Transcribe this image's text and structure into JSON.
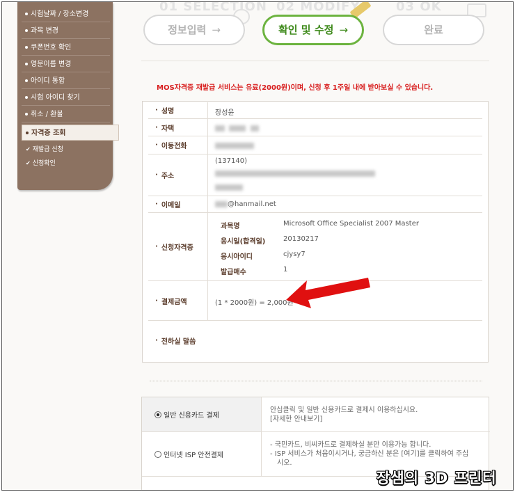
{
  "sidebar": {
    "items": [
      {
        "label": "시험날짜 / 장소변경"
      },
      {
        "label": "과목 변경"
      },
      {
        "label": "쿠폰번호 확인"
      },
      {
        "label": "영문이름 변경"
      },
      {
        "label": "아이디 통합"
      },
      {
        "label": "시험 아이디 찾기"
      },
      {
        "label": "취소 / 환불"
      },
      {
        "label": "자격증 조회"
      }
    ],
    "subitems": [
      {
        "label": "재발급 신청"
      },
      {
        "label": "신청확인"
      }
    ]
  },
  "steps": {
    "captions": [
      "01 SELECTION",
      "02 MODIFY",
      "03 OK"
    ],
    "items": [
      {
        "label": "정보입력",
        "arrow": "→"
      },
      {
        "label": "확인 및 수정",
        "arrow": "→"
      },
      {
        "label": "완료",
        "arrow": ""
      }
    ]
  },
  "notice": "MOS자격증 재발급 서비스는 유료(2000원)이며, 신청 후 1주일 내에 받아보실 수 있습니다.",
  "info": {
    "name_label": "성명",
    "name_value": "장성윤",
    "home_label": "자택",
    "mobile_label": "이동전화",
    "address_label": "주소",
    "postcode": "(137140)",
    "email_label": "이메일",
    "email_value": "@hanmail.net",
    "cert_label": "신청자격증",
    "cert": {
      "subject_label": "과목명",
      "subject_value": "Microsoft Office Specialist 2007 Master",
      "date_label": "응시일(합격일)",
      "date_value": "20130217",
      "id_label": "응시아이디",
      "id_value": "cjysy7",
      "count_label": "발급매수",
      "count_value": "1"
    },
    "pay_label": "결제금액",
    "pay_value": "(1 * 2000원) = 2,000원",
    "msg_label": "전하실 말씀"
  },
  "payment": {
    "card_label": "일반 신용카드 결제",
    "card_desc1": "안심클릭 및 일반 신용카드로 결제시 이용하십시요.",
    "card_desc2": "[자세한 안내보기]",
    "isp_label": "인터넷 ISP 안전결제",
    "isp_desc1": "- 국민카드, 비씨카드로 결제하실 분만 이용가능 합니다.",
    "isp_desc2": "- ISP 서비스가 처음이시거나, 궁금하신 분은 [여기]를 클릭하여 주십",
    "isp_desc3": "시오."
  },
  "watermark": "장샘의 3D 프린터",
  "colors": {
    "sidebar": "#8c7261",
    "active_step": "#6cb33f",
    "notice": "#d81e1e",
    "arrow": "#e01010"
  }
}
